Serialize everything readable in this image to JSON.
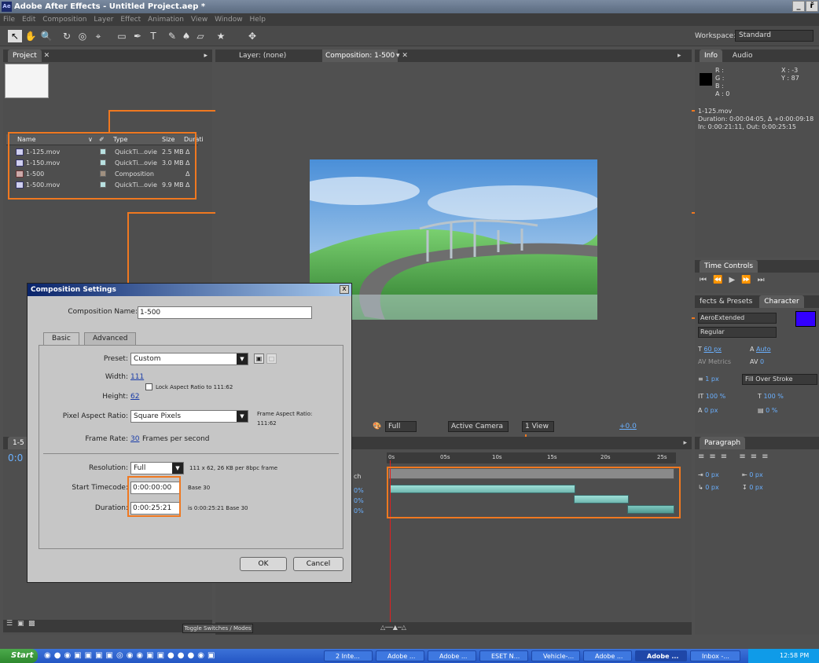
{
  "window": {
    "title": "Adobe After Effects - Untitled Project.aep *",
    "app_icon": "Ae",
    "minimize": "_",
    "restore": "ř"
  },
  "menu": [
    "File",
    "Edit",
    "Composition",
    "Layer",
    "Effect",
    "Animation",
    "View",
    "Window",
    "Help"
  ],
  "workspace": {
    "label": "Workspace:",
    "value": "Standard"
  },
  "project": {
    "tab": "Project",
    "columns": [
      "Name",
      "Type",
      "Size",
      "Durati"
    ],
    "items": [
      {
        "name": "1-125.mov",
        "type": "QuickTi...ovie",
        "size": "2.5 MB",
        "dur": "Δ"
      },
      {
        "name": "1-150.mov",
        "type": "QuickTi...ovie",
        "size": "3.0 MB",
        "dur": "Δ"
      },
      {
        "name": "1-500",
        "type": "Composition",
        "size": "",
        "dur": "Δ"
      },
      {
        "name": "1-500.mov",
        "type": "QuickTi...ovie",
        "size": "9.9 MB",
        "dur": "Δ"
      }
    ]
  },
  "viewer": {
    "layer_tab": "Layer: (none)",
    "comp_tab": "Composition: 1-500",
    "zoom": "Full",
    "camera": "Active Camera",
    "view": "1 View",
    "exposure": "+0.0"
  },
  "info": {
    "tab": "Info",
    "audio_tab": "Audio",
    "r": "R :",
    "g": "G :",
    "b": "B :",
    "a": "A : 0",
    "x": "X : -3",
    "y": "Y : 87",
    "file": "1-125.mov",
    "duration": "Duration: 0:00:04:05, Δ +0:00:09:18",
    "inout": "In: 0:00:21:11, Out: 0:00:25:15"
  },
  "time_controls": {
    "tab": "Time Controls"
  },
  "character": {
    "effects_tab": "fects & Presets",
    "tab": "Character",
    "font": "AeroExtended",
    "style": "Regular",
    "size": "60 px",
    "leading": "Auto",
    "kerning": "Metrics",
    "tracking": "0",
    "stroke": "1 px",
    "stroke_type": "Fill Over Stroke",
    "vscale": "100 %",
    "hscale": "100 %",
    "baseline": "0 px",
    "tsume": "0 %"
  },
  "paragraph": {
    "tab": "Paragraph",
    "indent1": "0 px",
    "indent2": "0 px",
    "indent3": "0 px",
    "space1": "0 px",
    "space2": "0 px"
  },
  "timeline": {
    "tab": "1-5",
    "time": "0:0",
    "ruler": [
      "0s",
      "05s",
      "10s",
      "15s",
      "20s",
      "25s"
    ],
    "col": "ch",
    "pcts": [
      "0%",
      "0%",
      "0%"
    ],
    "toggle": "Toggle Switches / Modes"
  },
  "dialog": {
    "title": "Composition Settings",
    "name_label": "Composition Name:",
    "name_value": "1-500",
    "tabs": [
      "Basic",
      "Advanced"
    ],
    "preset_label": "Preset:",
    "preset_value": "Custom",
    "width_label": "Width:",
    "width_value": "111",
    "height_label": "Height:",
    "height_value": "62",
    "lock_label": "Lock Aspect Ratio to 111:62",
    "par_label": "Pixel Aspect Ratio:",
    "par_value": "Square Pixels",
    "far_label": "Frame Aspect Ratio:",
    "far_value": "111:62",
    "fps_label": "Frame Rate:",
    "fps_value": "30",
    "fps_suffix": "Frames per second",
    "res_label": "Resolution:",
    "res_value": "Full",
    "res_info": "111 x 62, 26 KB per 8bpc frame",
    "stc_label": "Start Timecode:",
    "stc_value": "0:00:00:00",
    "stc_info": "Base 30",
    "dur_label": "Duration:",
    "dur_value": "0:00:25:21",
    "dur_info": "is 0:00:25:21 Base 30",
    "ok": "OK",
    "cancel": "Cancel",
    "close": "x"
  },
  "taskbar": {
    "start": "Start",
    "tasks": [
      "2 Inte...",
      "Adobe ...",
      "Adobe ...",
      "ESET N...",
      "Vehicle-...",
      "Adobe ...",
      "Adobe ...",
      "Inbox -..."
    ],
    "clock": "12:58 PM"
  },
  "colors": {
    "highlight": "#f07820",
    "title": "#5b6b80",
    "dialog_title": "#0a246a",
    "fill_color": "#3300ff"
  }
}
